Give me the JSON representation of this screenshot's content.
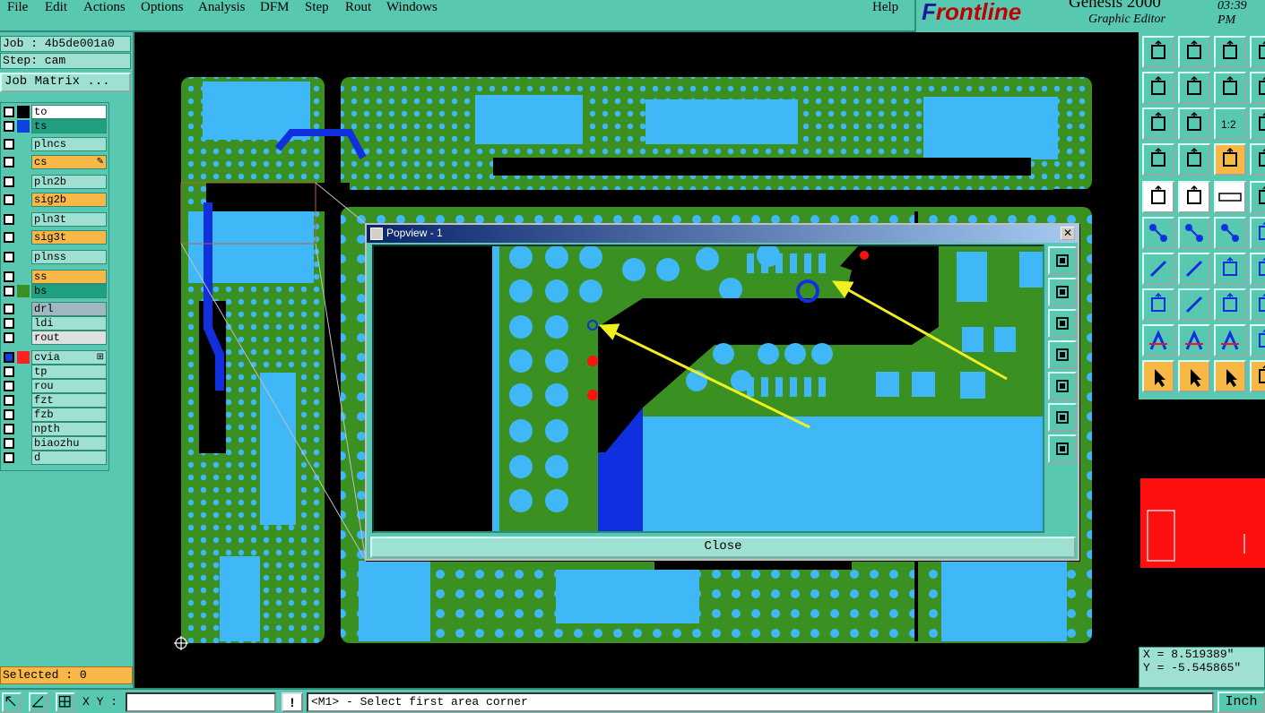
{
  "menu": {
    "items": [
      "File",
      "Edit",
      "Actions",
      "Options",
      "Analysis",
      "DFM",
      "Step",
      "Rout",
      "Windows"
    ],
    "help": "Help"
  },
  "brand": {
    "logo_accent": "F",
    "logo_rest": "rontline",
    "product": "Genesis 2000",
    "subtitle": "Graphic Editor",
    "time": "03:39 PM"
  },
  "job": {
    "job_line": "Job : 4b5de001a0",
    "step_line": "Step: cam",
    "matrix_button": "Job Matrix ..."
  },
  "layers": [
    {
      "name": "to",
      "bg": "#ffffff",
      "swatch": "#000000",
      "checked": false
    },
    {
      "name": "ts",
      "bg": "#20a080",
      "swatch": "#1040e0",
      "checked": false
    },
    {
      "name": "plncs",
      "bg": "#9ee0d2",
      "swatch": "",
      "checked": false
    },
    {
      "name": "cs",
      "bg": "#f8b848",
      "swatch": "",
      "checked": false,
      "marker": "✎"
    },
    {
      "name": "pln2b",
      "bg": "#9ee0d2",
      "swatch": "",
      "checked": false
    },
    {
      "name": "sig2b",
      "bg": "#f8b848",
      "swatch": "",
      "checked": false
    },
    {
      "name": "pln3t",
      "bg": "#9ee0d2",
      "swatch": "",
      "checked": false
    },
    {
      "name": "sig3t",
      "bg": "#f8b848",
      "swatch": "",
      "checked": false
    },
    {
      "name": "plnss",
      "bg": "#9ee0d2",
      "swatch": "",
      "checked": false
    },
    {
      "name": "ss",
      "bg": "#f8b848",
      "swatch": "",
      "checked": false
    },
    {
      "name": "bs",
      "bg": "#20a080",
      "swatch": "#3a9020",
      "checked": false
    },
    {
      "name": "drl",
      "bg": "#a0b8c0",
      "swatch": "",
      "checked": false
    },
    {
      "name": "ldi",
      "bg": "#9ee0d2",
      "swatch": "",
      "checked": false
    },
    {
      "name": "rout",
      "bg": "#e0e0e0",
      "swatch": "",
      "checked": false
    },
    {
      "name": "cvia",
      "bg": "#9ee0d2",
      "swatch": "#ff2020",
      "checked": true,
      "marker": "⊞"
    },
    {
      "name": "tp",
      "bg": "#9ee0d2",
      "swatch": "",
      "checked": false
    },
    {
      "name": "rou",
      "bg": "#9ee0d2",
      "swatch": "",
      "checked": false
    },
    {
      "name": "fzt",
      "bg": "#9ee0d2",
      "swatch": "",
      "checked": false
    },
    {
      "name": "fzb",
      "bg": "#9ee0d2",
      "swatch": "",
      "checked": false
    },
    {
      "name": "npth",
      "bg": "#9ee0d2",
      "swatch": "",
      "checked": false
    },
    {
      "name": "biaozhu",
      "bg": "#9ee0d2",
      "swatch": "",
      "checked": false
    },
    {
      "name": "d",
      "bg": "#9ee0d2",
      "swatch": "",
      "checked": false
    }
  ],
  "selected": "Selected : 0",
  "coords": {
    "x": "X = 8.519389\"",
    "y": "Y = -5.545865\""
  },
  "status": {
    "xy_label": "X Y :",
    "xy_value": "",
    "excl": "!",
    "prompt": "<M1> - Select first area corner",
    "units": "Inch"
  },
  "popview": {
    "title": "Popview - 1",
    "close_x": "✕",
    "close_button": "Close"
  },
  "colors": {
    "pcb_green": "#3a9020",
    "copper_blue": "#40b8f8",
    "mask_blue": "#1030e0",
    "via_red": "#ff1010",
    "arrow_yellow": "#f0f020",
    "panel_teal": "#58c8b0"
  }
}
